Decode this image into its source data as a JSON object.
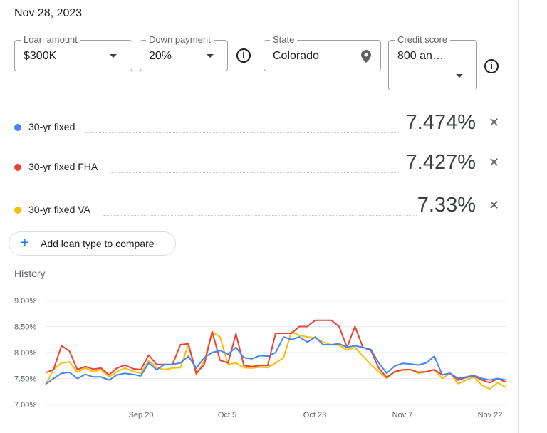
{
  "date": "Nov 28, 2023",
  "fields": {
    "loan_amount": {
      "label": "Loan amount",
      "value": "$300K"
    },
    "down_payment": {
      "label": "Down payment",
      "value": "20%"
    },
    "state": {
      "label": "State",
      "value": "Colorado"
    },
    "credit_score": {
      "label": "Credit score",
      "value": "800 an…"
    }
  },
  "rates": [
    {
      "label": "30-yr fixed",
      "value": "7.474%",
      "color": "#4285f4"
    },
    {
      "label": "30-yr fixed FHA",
      "value": "7.427%",
      "color": "#ea4335"
    },
    {
      "label": "30-yr fixed VA",
      "value": "7.33%",
      "color": "#fbbc04"
    }
  ],
  "add_button": {
    "label": "Add loan type to compare"
  },
  "history_title": "History",
  "icons": {
    "info": "info-icon",
    "remove": "close-icon",
    "add": "plus-icon",
    "location": "location-pin-icon",
    "dropdown": "caret-down-icon"
  },
  "chart_data": {
    "type": "line",
    "title": "History",
    "ylim": [
      7.0,
      9.0
    ],
    "yticks": [
      "9.00%",
      "8.50%",
      "8.00%",
      "7.50%",
      "7.00%"
    ],
    "xticks": [
      "Sep 20",
      "Oct 5",
      "Oct 23",
      "Nov 7",
      "Nov 22"
    ],
    "grid": true,
    "series": [
      {
        "name": "30-yr fixed",
        "color": "#4285f4",
        "values": [
          7.39,
          7.5,
          7.6,
          7.62,
          7.5,
          7.58,
          7.53,
          7.53,
          7.47,
          7.57,
          7.6,
          7.58,
          7.55,
          7.8,
          7.67,
          7.77,
          7.77,
          7.8,
          7.93,
          7.7,
          7.9,
          8.0,
          8.04,
          7.97,
          8.1,
          7.9,
          7.88,
          7.94,
          7.93,
          8.0,
          8.3,
          8.25,
          8.3,
          8.2,
          8.3,
          8.15,
          8.15,
          8.17,
          8.1,
          8.13,
          8.1,
          8.06,
          7.8,
          7.6,
          7.74,
          7.79,
          7.78,
          7.76,
          7.8,
          7.93,
          7.57,
          7.6,
          7.5,
          7.53,
          7.56,
          7.5,
          7.47,
          7.5,
          7.47
        ]
      },
      {
        "name": "30-yr fixed FHA",
        "color": "#ea4335",
        "values": [
          7.61,
          7.67,
          8.13,
          8.03,
          7.67,
          7.73,
          7.68,
          7.7,
          7.57,
          7.7,
          7.76,
          7.69,
          7.67,
          7.95,
          7.77,
          7.77,
          7.77,
          8.15,
          8.17,
          7.6,
          7.77,
          8.4,
          7.85,
          7.8,
          8.36,
          7.75,
          7.73,
          7.75,
          7.75,
          8.37,
          8.37,
          8.37,
          8.5,
          8.5,
          8.62,
          8.62,
          8.62,
          8.5,
          8.1,
          8.5,
          8.1,
          8.04,
          7.7,
          7.52,
          7.63,
          7.67,
          7.67,
          7.62,
          7.63,
          7.67,
          7.57,
          7.6,
          7.47,
          7.52,
          7.55,
          7.47,
          7.42,
          7.5,
          7.43
        ]
      },
      {
        "name": "30-yr fixed VA",
        "color": "#fbbc04",
        "values": [
          7.38,
          7.67,
          7.8,
          7.82,
          7.62,
          7.7,
          7.63,
          7.67,
          7.53,
          7.63,
          7.7,
          7.64,
          7.6,
          7.84,
          7.71,
          7.67,
          7.7,
          7.71,
          8.15,
          7.57,
          7.84,
          8.4,
          8.3,
          7.77,
          7.8,
          7.71,
          7.7,
          7.72,
          7.71,
          7.8,
          7.9,
          8.4,
          8.33,
          8.3,
          8.28,
          8.2,
          8.15,
          8.14,
          8.05,
          8.1,
          7.93,
          7.77,
          7.63,
          7.5,
          7.63,
          7.66,
          7.67,
          7.6,
          7.63,
          7.67,
          7.5,
          7.6,
          7.4,
          7.47,
          7.53,
          7.37,
          7.3,
          7.42,
          7.33
        ]
      }
    ]
  }
}
